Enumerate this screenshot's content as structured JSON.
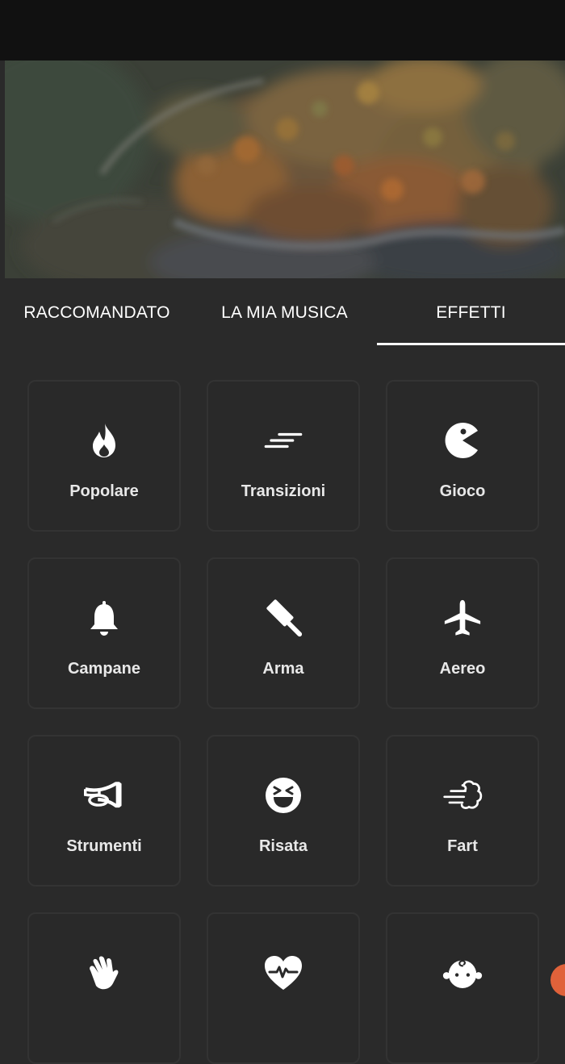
{
  "tabs": [
    {
      "label": "RACCOMANDATO",
      "active": false
    },
    {
      "label": "LA MIA MUSICA",
      "active": false
    },
    {
      "label": "EFFETTI",
      "active": true
    }
  ],
  "categories": [
    {
      "label": "Popolare",
      "icon": "fire-icon"
    },
    {
      "label": "Transizioni",
      "icon": "speed-lines-icon"
    },
    {
      "label": "Gioco",
      "icon": "pacman-icon"
    },
    {
      "label": "Campane",
      "icon": "bell-icon"
    },
    {
      "label": "Arma",
      "icon": "hammer-icon"
    },
    {
      "label": "Aereo",
      "icon": "airplane-icon"
    },
    {
      "label": "Strumenti",
      "icon": "horn-icon"
    },
    {
      "label": "Risata",
      "icon": "laughing-face-icon"
    },
    {
      "label": "Fart",
      "icon": "wind-cloud-icon"
    },
    {
      "label": "",
      "icon": "waving-hand-icon"
    },
    {
      "label": "",
      "icon": "heartbeat-icon"
    },
    {
      "label": "",
      "icon": "baby-face-icon"
    }
  ],
  "colors": {
    "background": "#2a2a2a",
    "card_border": "#333333",
    "active_underline": "#ffffff",
    "fab": "#e0623a"
  }
}
